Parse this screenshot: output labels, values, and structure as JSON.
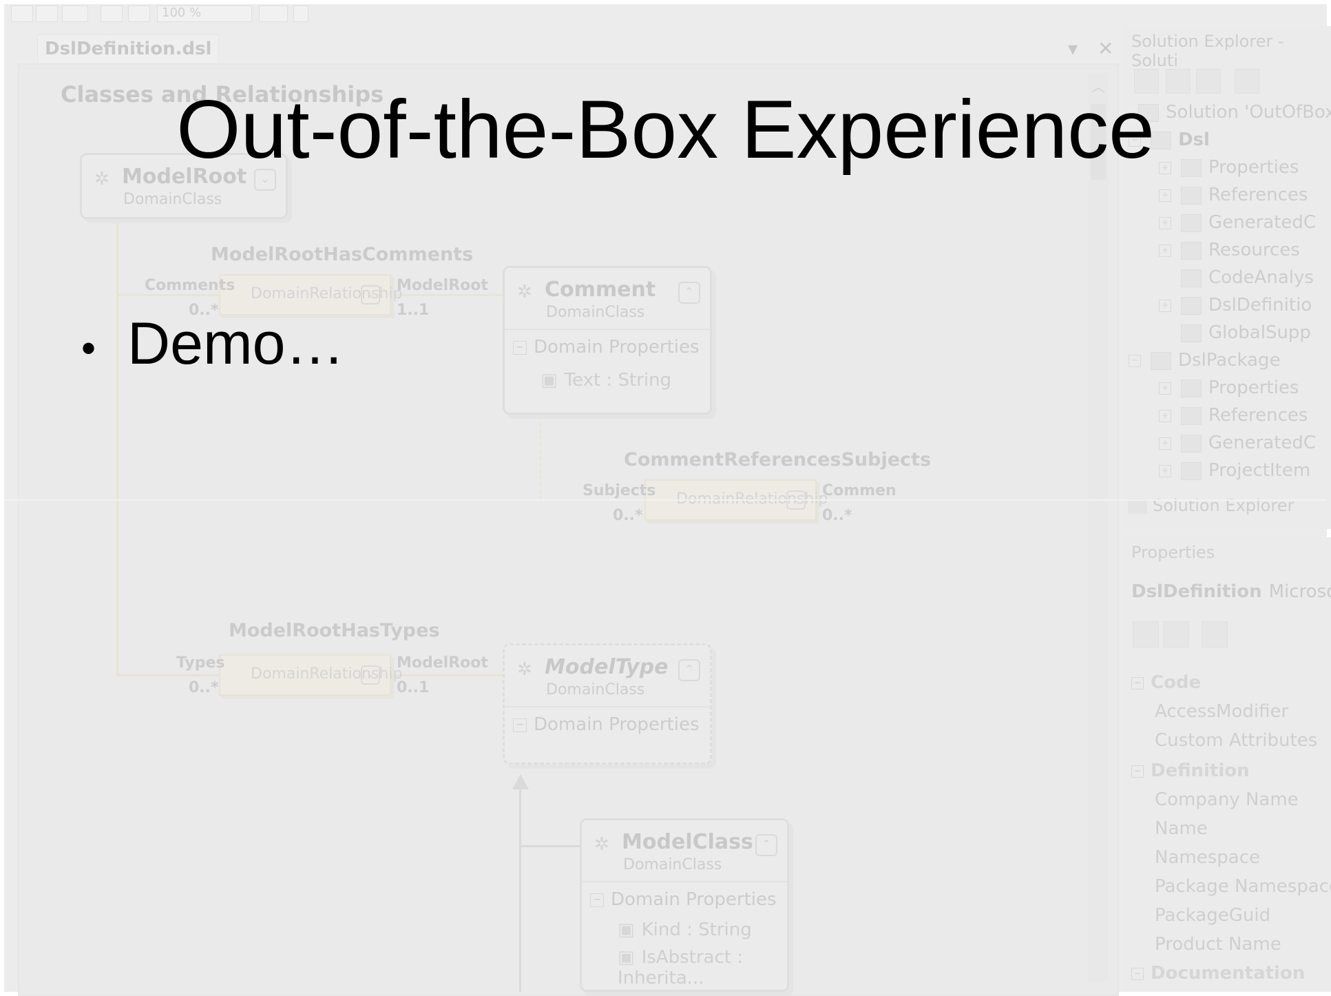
{
  "slide": {
    "title": "Out-of-the-Box Experience",
    "bullets": [
      "Demo…"
    ]
  },
  "ide": {
    "toolbar": {
      "zoom": "100 %"
    },
    "document_tab": "DslDefinition.dsl",
    "tab_controls": {
      "dropdown": "▾",
      "close": "✕"
    },
    "diagram_header": "Classes and Relationships",
    "classes": {
      "model_root": {
        "name": "ModelRoot",
        "kind": "DomainClass"
      },
      "comment": {
        "name": "Comment",
        "kind": "DomainClass",
        "section": "Domain Properties",
        "properties": [
          "Text : String"
        ]
      },
      "model_type": {
        "name": "ModelType",
        "kind": "DomainClass",
        "section": "Domain Properties"
      },
      "model_class": {
        "name": "ModelClass",
        "kind": "DomainClass",
        "section": "Domain Properties",
        "properties": [
          "Kind : String",
          "IsAbstract : Inherita..."
        ]
      }
    },
    "relationships": {
      "root_has_comments": {
        "name": "ModelRootHasComments",
        "kind": "DomainRelationship",
        "source_role": "Comments",
        "source_mult": "0..*",
        "target_role": "ModelRoot",
        "target_mult": "1..1"
      },
      "comment_refs_subjects": {
        "name": "CommentReferencesSubjects",
        "kind": "DomainRelationship",
        "source_role": "Subjects",
        "source_mult": "0..*",
        "target_role": "Commen",
        "target_mult": "0..*"
      },
      "root_has_types": {
        "name": "ModelRootHasTypes",
        "kind": "DomainRelationship",
        "source_role": "Types",
        "source_mult": "0..*",
        "target_role": "ModelRoot",
        "target_mult": "0..1"
      }
    },
    "solution_explorer": {
      "title": "Solution Explorer - Soluti",
      "items": [
        {
          "label": "Solution 'OutOfBox",
          "expander": ""
        },
        {
          "label": "Dsl",
          "expander": "−"
        },
        {
          "label": "Properties",
          "expander": "+"
        },
        {
          "label": "References",
          "expander": "+"
        },
        {
          "label": "GeneratedC",
          "expander": "+"
        },
        {
          "label": "Resources",
          "expander": "+"
        },
        {
          "label": "CodeAnalys",
          "expander": ""
        },
        {
          "label": "DslDefinitio",
          "expander": "+"
        },
        {
          "label": "GlobalSupp",
          "expander": ""
        },
        {
          "label": "DslPackage",
          "expander": "−"
        },
        {
          "label": "Properties",
          "expander": "+"
        },
        {
          "label": "References",
          "expander": "+"
        },
        {
          "label": "GeneratedC",
          "expander": "+"
        },
        {
          "label": "ProjectItem",
          "expander": "+"
        }
      ],
      "footer_tab": "Solution Explorer"
    },
    "properties": {
      "title": "Properties",
      "object_name": "DslDefinition",
      "object_type": "Microsoft",
      "categories": [
        {
          "name": "Code",
          "rows": [
            "AccessModifier",
            "Custom Attributes"
          ]
        },
        {
          "name": "Definition",
          "rows": [
            "Company Name",
            "Name",
            "Namespace",
            "Package Namespace",
            "PackageGuid",
            "Product Name"
          ]
        },
        {
          "name": "Documentation",
          "rows": []
        }
      ]
    }
  }
}
